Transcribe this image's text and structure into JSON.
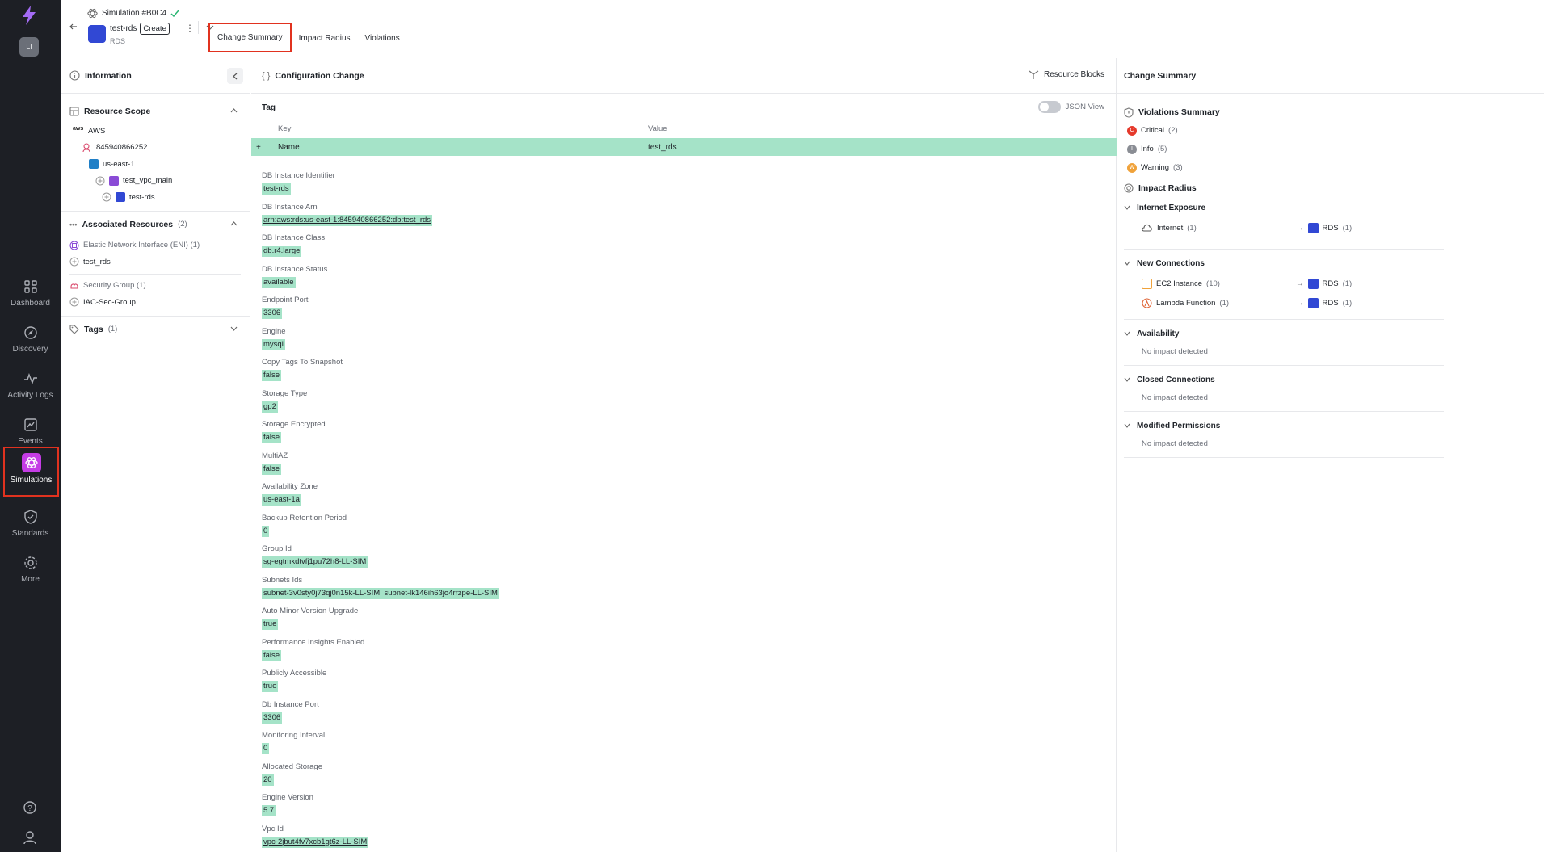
{
  "nav": {
    "avatar": "LI",
    "items": [
      {
        "label": "Dashboard",
        "icon": "dashboard-icon"
      },
      {
        "label": "Discovery",
        "icon": "discovery-icon"
      },
      {
        "label": "Activity Logs",
        "icon": "activity-icon"
      },
      {
        "label": "Events",
        "icon": "events-icon"
      },
      {
        "label": "Simulations",
        "icon": "simulations-icon",
        "active": true
      },
      {
        "label": "Standards",
        "icon": "shield-icon"
      },
      {
        "label": "More",
        "icon": "gear-icon"
      }
    ]
  },
  "header": {
    "simulation_title": "Simulation #B0C4",
    "resource_name": "test-rds",
    "action_badge": "Create",
    "resource_type": "RDS",
    "tabs": [
      "Change Summary",
      "Impact Radius",
      "Violations"
    ],
    "active_tab": "Change Summary"
  },
  "left": {
    "title": "Information",
    "resource_scope": {
      "title": "Resource Scope",
      "tree": [
        "AWS",
        "845940866252",
        "us-east-1",
        "test_vpc_main",
        "test-rds"
      ]
    },
    "associated": {
      "title": "Associated Resources",
      "count": "(2)",
      "groups": [
        {
          "type": "Elastic Network Interface (ENI) (1)",
          "item": "test_rds"
        },
        {
          "type": "Security Group (1)",
          "item": "IAC-Sec-Group"
        }
      ]
    },
    "tags": {
      "title": "Tags",
      "count": "(1)"
    }
  },
  "middle": {
    "title": "Configuration Change",
    "resource_blocks": "Resource Blocks",
    "tag_section": "Tag",
    "json_view": "JSON View",
    "kv_header": {
      "key": "Key",
      "value": "Value"
    },
    "kv_row": {
      "sign": "+",
      "key": "Name",
      "value": "test_rds"
    },
    "properties": [
      {
        "label": "DB Instance Identifier",
        "value": "test-rds"
      },
      {
        "label": "DB Instance Arn",
        "value": "arn:aws:rds:us-east-1:845940866252:db:test_rds",
        "link": true
      },
      {
        "label": "DB Instance Class",
        "value": "db.r4.large"
      },
      {
        "label": "DB Instance Status",
        "value": "available"
      },
      {
        "label": "Endpoint Port",
        "value": "3306"
      },
      {
        "label": "Engine",
        "value": "mysql"
      },
      {
        "label": "Copy Tags To Snapshot",
        "value": "false"
      },
      {
        "label": "Storage Type",
        "value": "gp2"
      },
      {
        "label": "Storage Encrypted",
        "value": "false"
      },
      {
        "label": "MultiAZ",
        "value": "false"
      },
      {
        "label": "Availability Zone",
        "value": "us-east-1a"
      },
      {
        "label": "Backup Retention Period",
        "value": "0"
      },
      {
        "label": "Group Id",
        "value": "sg-egtmkdtvfj1pu72h8-LL-SIM",
        "link": true
      },
      {
        "label": "Subnets Ids",
        "value": "subnet-3v0sty0j73qj0n15k-LL-SIM, subnet-lk146ih63jo4rrzpe-LL-SIM"
      },
      {
        "label": "Auto Minor Version Upgrade",
        "value": "true"
      },
      {
        "label": "Performance Insights Enabled",
        "value": "false"
      },
      {
        "label": "Publicly Accessible",
        "value": "true"
      },
      {
        "label": "Db Instance Port",
        "value": "3306"
      },
      {
        "label": "Monitoring Interval",
        "value": "0"
      },
      {
        "label": "Allocated Storage",
        "value": "20"
      },
      {
        "label": "Engine Version",
        "value": "5.7"
      },
      {
        "label": "Vpc Id",
        "value": "vpc-2jbut4fv7xcb1gt6z-LL-SIM",
        "link": true
      }
    ]
  },
  "right": {
    "title": "Change Summary",
    "violations_title": "Violations Summary",
    "violations": [
      {
        "letter": "C",
        "label": "Critical",
        "count": "(2)",
        "color": "#e5392b"
      },
      {
        "letter": "I",
        "label": "Info",
        "count": "(5)",
        "color": "#8a8d94"
      },
      {
        "letter": "W",
        "label": "Warning",
        "count": "(3)",
        "color": "#f0a23a"
      }
    ],
    "impact_title": "Impact Radius",
    "groups": [
      {
        "title": "Internet Exposure",
        "rows": [
          {
            "left": "Internet",
            "left_count": "(1)",
            "right": "RDS",
            "right_count": "(1)"
          }
        ]
      },
      {
        "title": "New Connections",
        "rows": [
          {
            "left": "EC2 Instance",
            "left_count": "(10)",
            "right": "RDS",
            "right_count": "(1)"
          },
          {
            "left": "Lambda Function",
            "left_count": "(1)",
            "right": "RDS",
            "right_count": "(1)"
          }
        ]
      },
      {
        "title": "Availability",
        "empty": "No impact detected"
      },
      {
        "title": "Closed Connections",
        "empty": "No impact detected"
      },
      {
        "title": "Modified Permissions",
        "empty": "No impact detected"
      }
    ]
  }
}
